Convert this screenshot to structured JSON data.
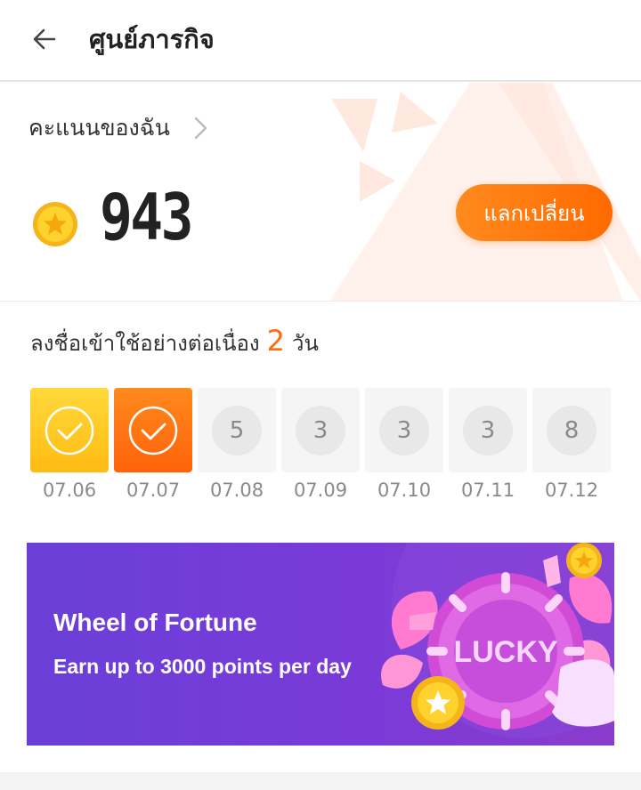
{
  "header": {
    "title": "ศูนย์ภารกิจ"
  },
  "points": {
    "label": "คะแนนของฉัน",
    "value": "943",
    "exchange_label": "แลกเปลี่ยน"
  },
  "checkin": {
    "prefix": "ลงชื่อเข้าใช้อย่างต่อเนื่อง",
    "count": "2",
    "suffix": "วัน",
    "days": [
      {
        "date": "07.06",
        "state": "checked"
      },
      {
        "date": "07.07",
        "state": "checked-today"
      },
      {
        "date": "07.08",
        "reward": "5"
      },
      {
        "date": "07.09",
        "reward": "3"
      },
      {
        "date": "07.10",
        "reward": "3"
      },
      {
        "date": "07.11",
        "reward": "3"
      },
      {
        "date": "07.12",
        "reward": "8"
      }
    ]
  },
  "banner": {
    "title": "Wheel of Fortune",
    "subtitle": "Earn up to 3000 points per day",
    "wheel_text": "LUCKY"
  },
  "colors": {
    "accent": "#ff6a13",
    "banner": "#7b3ad7"
  }
}
